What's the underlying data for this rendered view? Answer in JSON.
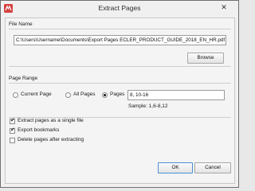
{
  "window": {
    "title": "Extract Pages",
    "close_glyph": "✕",
    "icon": "app-logo-icon"
  },
  "file_name": {
    "group_label": "File Name",
    "path_value": "C:\\Users\\Username\\Documents\\Export Pages ECLER_PRODUCT_GUIDE_2018_EN_HR.pdf",
    "browse_label": "Browse"
  },
  "page_range": {
    "group_label": "Page Range",
    "options": [
      {
        "label": "Current Page",
        "selected": false
      },
      {
        "label": "All Pages",
        "selected": false
      },
      {
        "label": "Pages",
        "selected": true
      }
    ],
    "pages_value": "8, 10-16",
    "sample_text": "Sample: 1,6-8,12"
  },
  "options": [
    {
      "label": "Extract pages as a single file",
      "checked": true
    },
    {
      "label": "Export bookmarks",
      "checked": true
    },
    {
      "label": "Delete pages after extracting",
      "checked": false
    }
  ],
  "buttons": {
    "ok": "OK",
    "cancel": "Cancel"
  },
  "colors": {
    "accent": "#4b8fd6",
    "app_icon": "#d64040"
  }
}
